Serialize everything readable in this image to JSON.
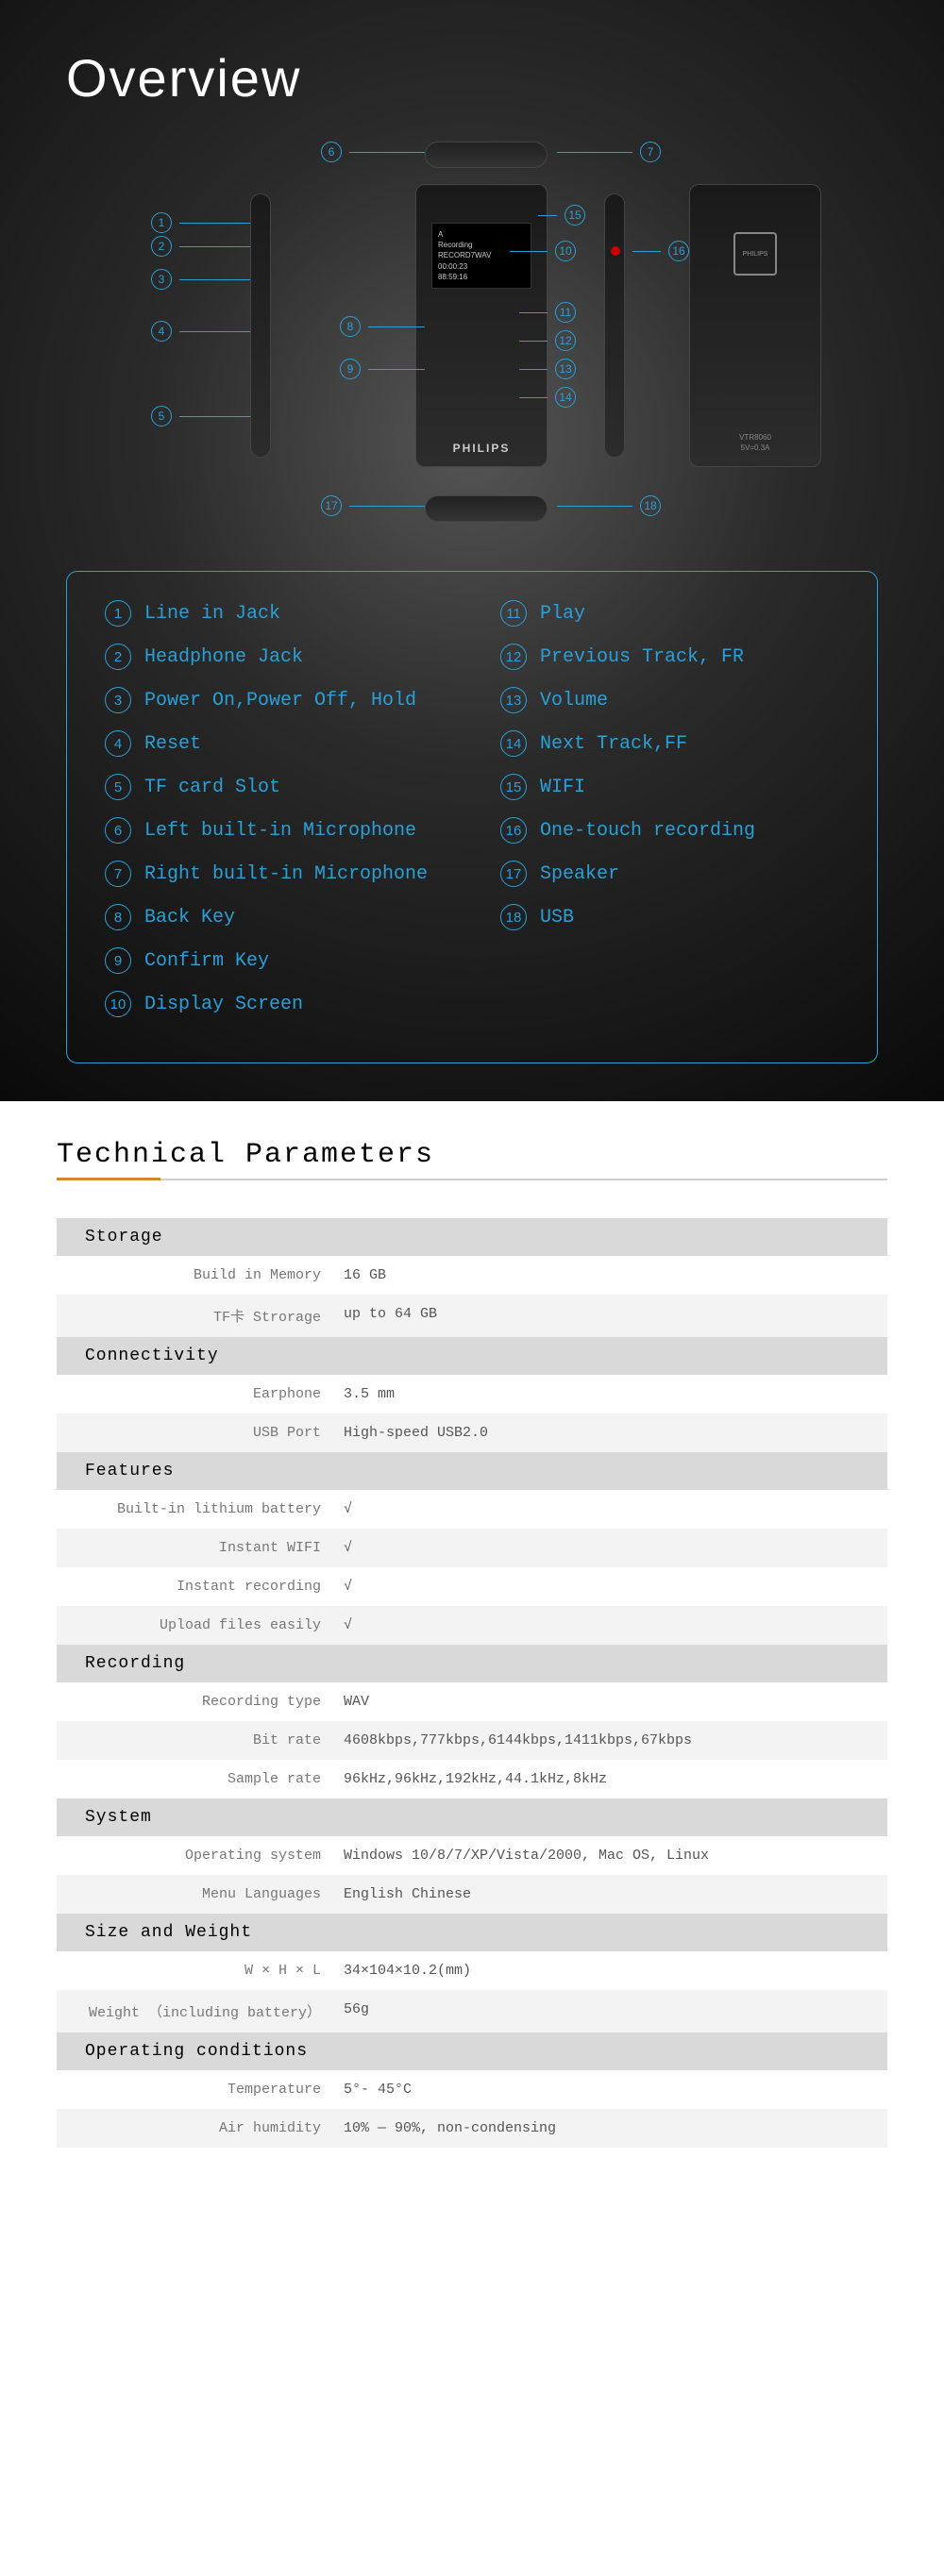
{
  "overview": {
    "title": "Overview",
    "screen": {
      "line1": "A",
      "line2": "Recording",
      "line3": "RECORD7WAV",
      "line4": "00:00:23",
      "line5": "88:59:16"
    },
    "brand": "PHILIPS",
    "back_model": "VTR8060",
    "back_spec": "5V=0.3A"
  },
  "callouts": {
    "c1": "1",
    "c2": "2",
    "c3": "3",
    "c4": "4",
    "c5": "5",
    "c6": "6",
    "c7": "7",
    "c8": "8",
    "c9": "9",
    "c10": "10",
    "c11": "11",
    "c12": "12",
    "c13": "13",
    "c14": "14",
    "c15": "15",
    "c16": "16",
    "c17": "17",
    "c18": "18"
  },
  "legend": {
    "col1": [
      {
        "n": "1",
        "label": "Line in Jack"
      },
      {
        "n": "2",
        "label": "Headphone Jack"
      },
      {
        "n": "3",
        "label": "Power On,Power Off, Hold"
      },
      {
        "n": "4",
        "label": "Reset"
      },
      {
        "n": "5",
        "label": "TF card Slot"
      },
      {
        "n": "6",
        "label": "Left built-in Microphone"
      },
      {
        "n": "7",
        "label": "Right built-in Microphone"
      },
      {
        "n": "8",
        "label": "Back Key"
      },
      {
        "n": "9",
        "label": "Confirm Key"
      },
      {
        "n": "10",
        "label": "Display Screen"
      }
    ],
    "col2": [
      {
        "n": "11",
        "label": "Play"
      },
      {
        "n": "12",
        "label": "Previous Track, FR"
      },
      {
        "n": "13",
        "label": "Volume"
      },
      {
        "n": "14",
        "label": "Next Track,FF"
      },
      {
        "n": "15",
        "label": "WIFI"
      },
      {
        "n": "16",
        "label": "One-touch recording"
      },
      {
        "n": "17",
        "label": "Speaker"
      },
      {
        "n": "18",
        "label": "USB"
      }
    ]
  },
  "tech": {
    "title": "Technical Parameters",
    "groups": [
      {
        "header": "Storage",
        "rows": [
          {
            "label": "Build in Memory",
            "value": "16 GB",
            "alt": false
          },
          {
            "label": "TF卡 Strorage",
            "value": "up to 64 GB",
            "alt": true
          }
        ]
      },
      {
        "header": "Connectivity",
        "rows": [
          {
            "label": "Earphone",
            "value": "3.5 mm",
            "alt": false
          },
          {
            "label": "USB Port",
            "value": "High-speed USB2.0",
            "alt": true
          }
        ]
      },
      {
        "header": "Features",
        "rows": [
          {
            "label": "Built-in lithium battery",
            "value": "√",
            "alt": false
          },
          {
            "label": "Instant WIFI",
            "value": "√",
            "alt": true
          },
          {
            "label": "Instant recording",
            "value": "√",
            "alt": false
          },
          {
            "label": "Upload files easily",
            "value": "√",
            "alt": true
          }
        ]
      },
      {
        "header": "Recording",
        "rows": [
          {
            "label": "Recording type",
            "value": "WAV",
            "alt": false
          },
          {
            "label": "Bit rate",
            "value": "4608kbps,777kbps,6144kbps,1411kbps,67kbps",
            "alt": true
          },
          {
            "label": "Sample rate",
            "value": "96kHz,96kHz,192kHz,44.1kHz,8kHz",
            "alt": false
          }
        ]
      },
      {
        "header": "System",
        "rows": [
          {
            "label": "Operating system",
            "value": "Windows 10/8/7/XP/Vista/2000, Mac OS, Linux",
            "alt": false
          },
          {
            "label": "Menu Languages",
            "value": "English  Chinese",
            "alt": true
          }
        ]
      },
      {
        "header": "Size and Weight",
        "rows": [
          {
            "label": "W × H × L",
            "value": "34×104×10.2(mm)",
            "alt": false
          },
          {
            "label": "Weight （including battery）",
            "value": "56g",
            "alt": true
          }
        ]
      },
      {
        "header": "Operating conditions",
        "rows": [
          {
            "label": "Temperature",
            "value": "5°- 45°C",
            "alt": false
          },
          {
            "label": "Air humidity",
            "value": "10% — 90%, non-condensing",
            "alt": true
          }
        ]
      }
    ]
  }
}
